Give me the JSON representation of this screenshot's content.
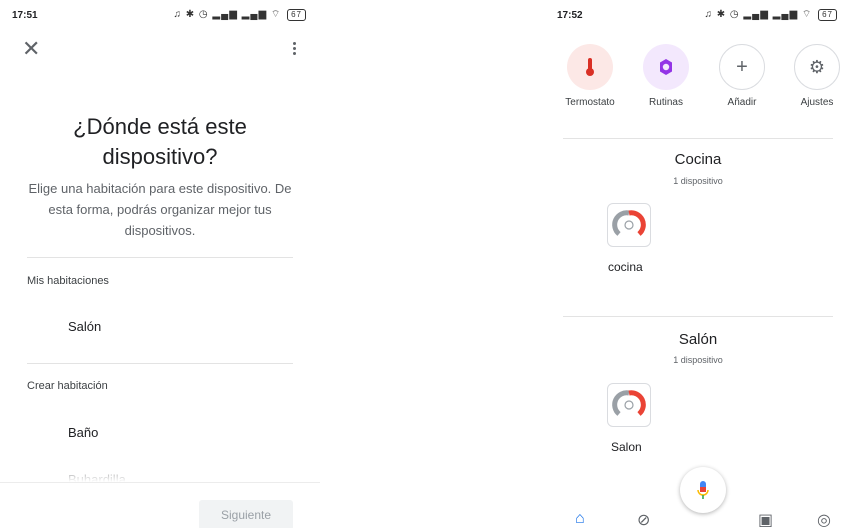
{
  "left_screen": {
    "status": {
      "time": "17:51",
      "battery": "67"
    },
    "title": "¿Dónde está este dispositivo?",
    "description": "Elige una habitación para este dispositivo. De esta forma, podrás organizar mejor tus dispositivos.",
    "my_rooms": {
      "header": "Mis habitaciones",
      "items": [
        "Salón"
      ]
    },
    "create_room": {
      "header": "Crear habitación",
      "items": [
        "Baño",
        "Buhardilla"
      ]
    },
    "next_button": "Siguiente"
  },
  "right_screen": {
    "status": {
      "time": "17:52",
      "battery": "67"
    },
    "quick_actions": [
      {
        "label": "Termostato",
        "icon": "thermometer-icon",
        "bg": "#fce8e6",
        "color": "#d93025"
      },
      {
        "label": "Rutinas",
        "icon": "routines-icon",
        "bg": "#f3e8fd",
        "color": "#9334e6"
      },
      {
        "label": "Añadir",
        "icon": "plus-icon",
        "bg": "#ffffff",
        "color": "#5f6368"
      },
      {
        "label": "Ajustes",
        "icon": "gear-icon",
        "bg": "#ffffff",
        "color": "#5f6368"
      }
    ],
    "rooms": [
      {
        "name": "Cocina",
        "count": "1 dispositivo",
        "device": "cocina"
      },
      {
        "name": "Salón",
        "count": "1 dispositivo",
        "device": "Salon"
      }
    ],
    "nav": [
      "home-icon",
      "explore-icon",
      "media-icon",
      "account-icon"
    ],
    "colors": {
      "accent": "#1a73e8",
      "gauge_red": "#ea4335",
      "gauge_gray": "#9aa0a6"
    }
  }
}
